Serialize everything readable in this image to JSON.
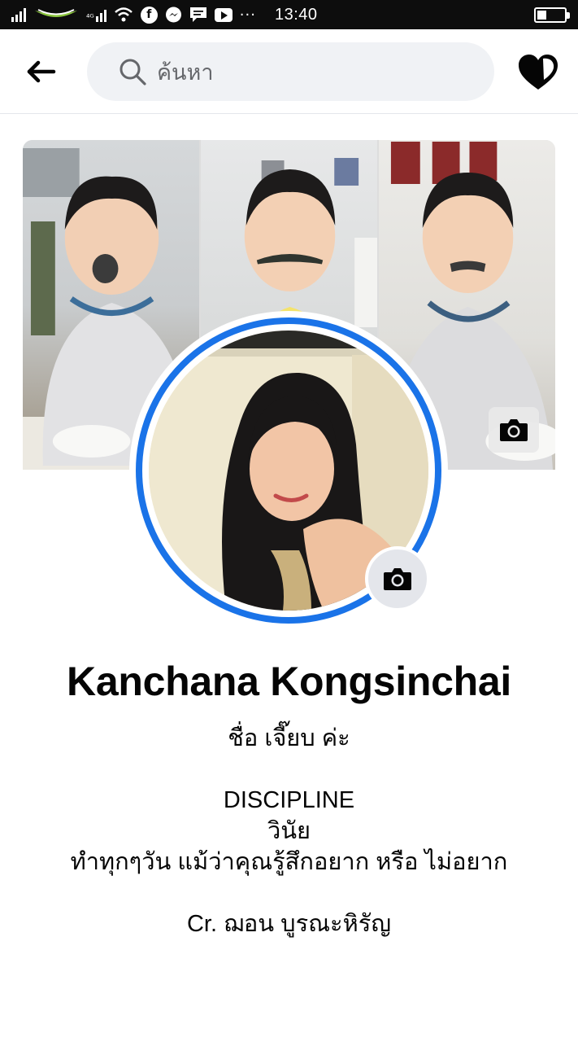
{
  "status_bar": {
    "time": "13:40",
    "icons": [
      "signal-icon",
      "carrier-logo-icon",
      "lte-signal-icon",
      "wifi-icon",
      "facebook-icon",
      "messenger-icon",
      "message-icon",
      "youtube-icon",
      "more-icon",
      "battery-icon"
    ],
    "lte_label": "⁴ᴳ",
    "facebook_glyph": "f",
    "more_glyph": "···"
  },
  "header": {
    "search_placeholder": "ค้นหา"
  },
  "profile": {
    "name": "Kanchana Kongsinchai",
    "bio": {
      "line1": "ชื่อ เจี๊ยบ ค่ะ",
      "line2": "DISCIPLINE",
      "line3": "วินัย",
      "line4": "ทำทุกๆวัน แม้ว่าคุณรู้สึกอยาก หรือ ไม่อยาก",
      "line5": "Cr. ฌอน บูรณะหิรัญ"
    }
  },
  "colors": {
    "accent_ring": "#1a73e8",
    "status_bar_bg": "#0d0d0d",
    "search_bg": "#f0f2f5",
    "carrier_green": "#8cc63f"
  }
}
